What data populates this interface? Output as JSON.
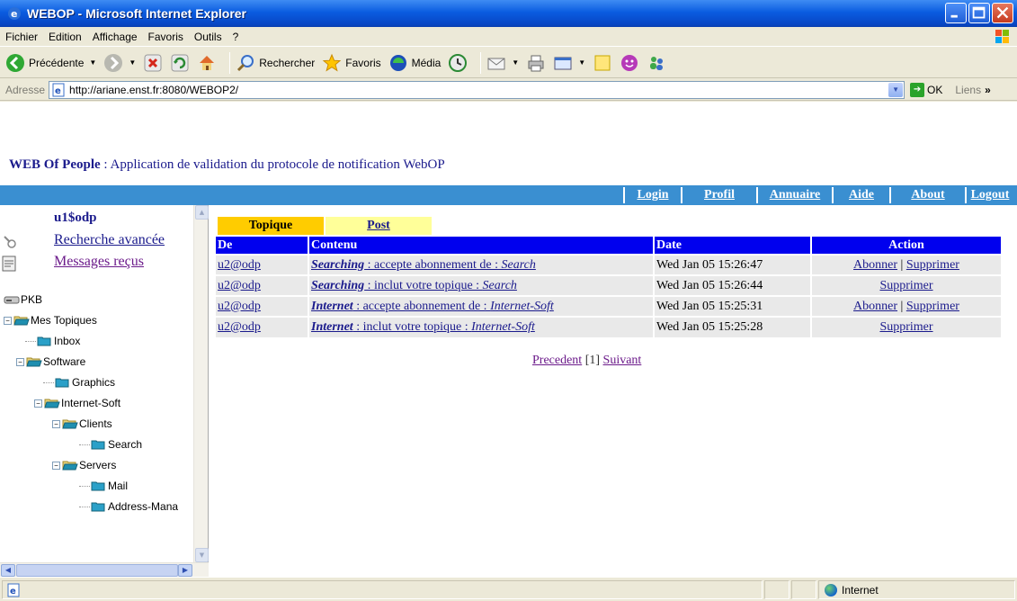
{
  "window": {
    "title": "WEBOP - Microsoft Internet Explorer"
  },
  "menu": [
    "Fichier",
    "Edition",
    "Affichage",
    "Favoris",
    "Outils",
    "?"
  ],
  "toolbar": {
    "back_label": "Précédente",
    "search_label": "Rechercher",
    "favorites_label": "Favoris",
    "media_label": "Média"
  },
  "address": {
    "label": "Adresse",
    "url": "http://ariane.enst.fr:8080/WEBOP2/",
    "go_label": "OK",
    "links_label": "Liens"
  },
  "page": {
    "title_bold": "WEB Of People",
    "title_rest": " : Application de validation du protocole de notification WebOP"
  },
  "nav": [
    "Login",
    "Profil",
    "Annuaire",
    "Aide",
    "About",
    "Logout"
  ],
  "sidebar": {
    "user": "u1$odp",
    "search_link": "Recherche avancée",
    "messages_link": "Messages reçus",
    "tree": [
      {
        "label": "PKB",
        "level": 0,
        "kind": "drive"
      },
      {
        "label": "Mes Topiques",
        "level": 0,
        "kind": "folder-open",
        "expander": "−"
      },
      {
        "label": "Inbox",
        "level": 1,
        "kind": "folder"
      },
      {
        "label": "Software",
        "level": 1,
        "kind": "folder-open",
        "expander": "−"
      },
      {
        "label": "Graphics",
        "level": 2,
        "kind": "folder"
      },
      {
        "label": "Internet-Soft",
        "level": 2,
        "kind": "folder-open",
        "expander": "−"
      },
      {
        "label": "Clients",
        "level": 3,
        "kind": "folder-open",
        "expander": "−"
      },
      {
        "label": "Search",
        "level": 4,
        "kind": "folder"
      },
      {
        "label": "Servers",
        "level": 3,
        "kind": "folder-open",
        "expander": "−"
      },
      {
        "label": "Mail",
        "level": 4,
        "kind": "folder"
      },
      {
        "label": "Address-Mana",
        "level": 4,
        "kind": "folder"
      }
    ]
  },
  "tabs": {
    "active": "Topique",
    "other": "Post"
  },
  "table": {
    "headers": [
      "De",
      "Contenu",
      "Date",
      "Action"
    ],
    "rows": [
      {
        "from": "u2@odp",
        "topic": "Searching",
        "text": " : accepte abonnement de : ",
        "target": "Search",
        "date": "Wed Jan 05 15:26:47",
        "subscribe": "Abonner",
        "sep": " | ",
        "delete": "Supprimer"
      },
      {
        "from": "u2@odp",
        "topic": "Searching",
        "text": " : inclut votre topique : ",
        "target": "Search",
        "date": "Wed Jan 05 15:26:44",
        "subscribe": "",
        "sep": "",
        "delete": "Supprimer"
      },
      {
        "from": "u2@odp",
        "topic": "Internet",
        "text": " : accepte abonnement de : ",
        "target": "Internet-Soft",
        "date": "Wed Jan 05 15:25:31",
        "subscribe": "Abonner",
        "sep": " | ",
        "delete": "Supprimer"
      },
      {
        "from": "u2@odp",
        "topic": "Internet",
        "text": " : inclut votre topique : ",
        "target": "Internet-Soft",
        "date": "Wed Jan 05 15:25:28",
        "subscribe": "",
        "sep": "",
        "delete": "Supprimer"
      }
    ]
  },
  "pager": {
    "prev": "Precedent",
    "current": " [1] ",
    "next": "Suivant"
  },
  "status": {
    "zone": "Internet"
  }
}
